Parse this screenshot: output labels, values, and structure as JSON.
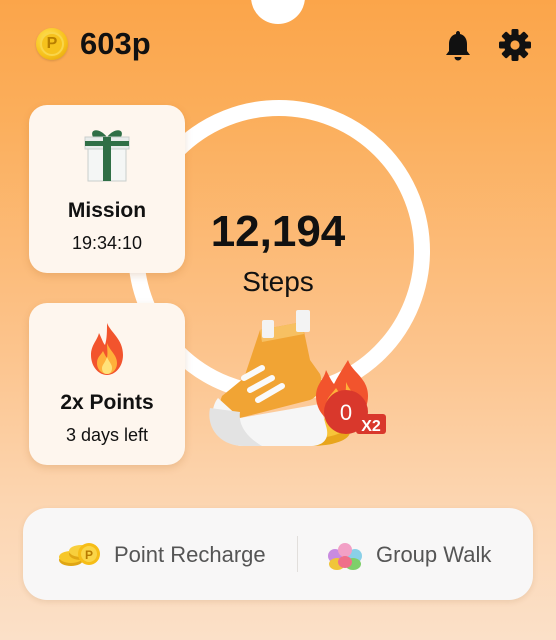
{
  "header": {
    "coin_symbol": "P",
    "points": "603p",
    "icons": [
      "bell-icon",
      "gear-icon"
    ]
  },
  "steps": {
    "count": "12,194",
    "label": "Steps"
  },
  "mission_card": {
    "title": "Mission",
    "timer": "19:34:10",
    "icon": "gift-icon"
  },
  "points_card": {
    "title": "2x Points",
    "subtitle": "3 days left",
    "icon": "flame-icon"
  },
  "boost_badge": {
    "count": "0",
    "multiplier": "X2"
  },
  "bottom_bar": {
    "recharge_label": "Point Recharge",
    "group_label": "Group Walk"
  },
  "colors": {
    "background_top": "#fba54a",
    "background_bottom": "#fbe0c8",
    "card": "#fef6ee",
    "badge_red": "#d9382c",
    "text": "#111111"
  }
}
